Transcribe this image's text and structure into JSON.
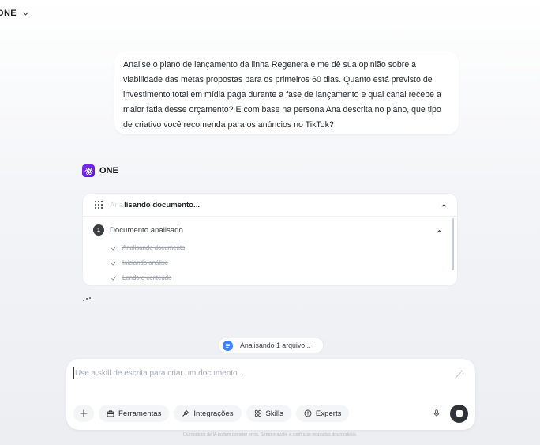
{
  "header": {
    "model_label": "ONE"
  },
  "user_message": "Analise o plano de lançamento da linha Regenera e me dê sua opinião sobre a viabilidade das metas propostas para os primeiros 60 dias. Quanto está previsto de investimento total em mídia paga durante a fase de lançamento e qual canal recebe a maior fatia desse orçamento? E com base na persona Ana descrita no plano, que tipo de criativo você recomenda para os anúncios no TikTok?",
  "assistant": {
    "name": "ONE"
  },
  "progress": {
    "status_ghost": "Ana",
    "status": "lisando documento...",
    "step_number": "1",
    "step_label": "Documento analisado",
    "substeps": [
      "Analisando documento",
      "Iniciando análise",
      "Lendo o conteúdo"
    ]
  },
  "file_chip": {
    "label": "Analisando 1 arquivo..."
  },
  "composer": {
    "placeholder": "Use a skill de escrita para criar um documento...",
    "tools": {
      "ferramentas": "Ferramentas",
      "integracoes": "Integrações",
      "skills": "Skills",
      "experts": "Experts"
    }
  },
  "disclaimer": "Os modelos de IA podem cometer erros. Sempre avalie e confira as respostas dos modelos.",
  "colors": {
    "brand": "#6a22e0",
    "accent_blue": "#3b82f6",
    "stop_button": "#2f3236"
  }
}
